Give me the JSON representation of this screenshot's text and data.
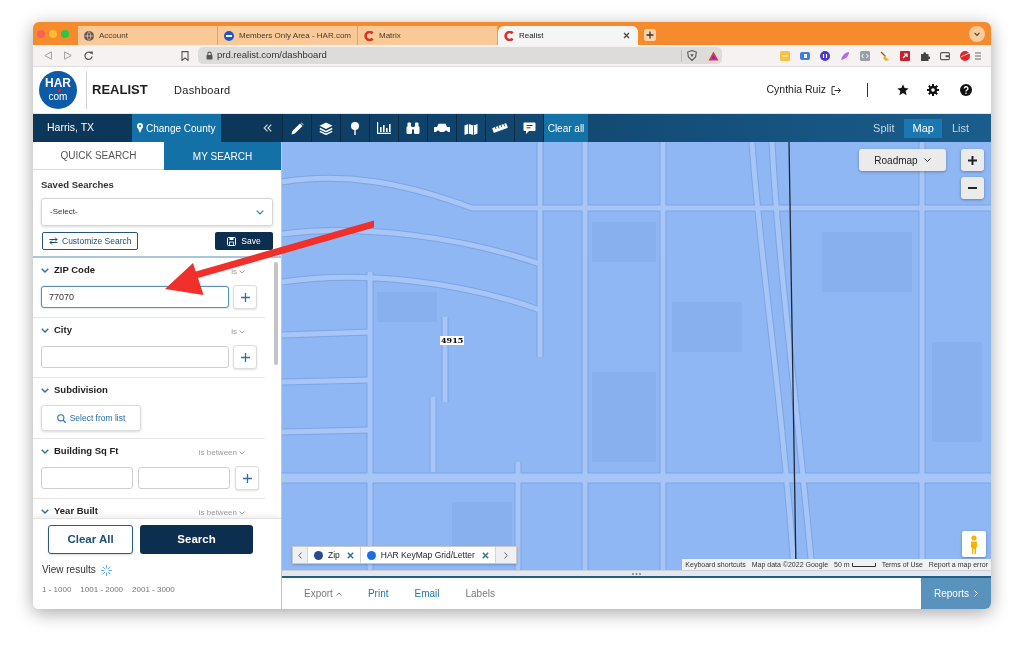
{
  "browser": {
    "tabs": [
      {
        "title": "Account",
        "selected": false
      },
      {
        "title": "Members Only Area - HAR.com",
        "selected": false
      },
      {
        "title": "Matrix",
        "selected": false
      },
      {
        "title": "Realist",
        "selected": true
      }
    ],
    "url": "prd.realist.com/dashboard"
  },
  "header": {
    "logo_top": "HAR",
    "logo_bottom": "com",
    "brand": "REALIST",
    "page_title": "Dashboard",
    "user_name": "Cynthia Ruiz"
  },
  "nav_bar": {
    "county": "Harris, TX",
    "change_county": "Change County",
    "clear_all": "Clear all",
    "views": [
      {
        "label": "Split",
        "selected": false
      },
      {
        "label": "Map",
        "selected": true
      },
      {
        "label": "List",
        "selected": false
      }
    ]
  },
  "sidebar": {
    "tabs": [
      {
        "label": "QUICK SEARCH",
        "selected": false
      },
      {
        "label": "MY SEARCH",
        "selected": true
      }
    ],
    "saved_searches": {
      "label": "Saved Searches",
      "value": "-Select-"
    },
    "customize_button": "Customize Search",
    "save_button": "Save",
    "sections": [
      {
        "kind": "single",
        "title": "ZIP Code",
        "operator": "is",
        "expanded": true,
        "value": "77070",
        "focused": true
      },
      {
        "kind": "single",
        "title": "City",
        "operator": "is",
        "expanded": true,
        "focused": false
      },
      {
        "kind": "list",
        "title": "Subdivision",
        "expanded": true,
        "button": "Select from list"
      },
      {
        "kind": "range",
        "title": "Building Sq Ft",
        "operator": "is between",
        "expanded": true
      },
      {
        "kind": "range",
        "title": "Year Built",
        "operator": "is between",
        "expanded": true
      }
    ],
    "clear_button": "Clear All",
    "search_button": "Search",
    "view_results": "View results",
    "result_ranges": [
      "1 - 1000",
      "1001 - 2000",
      "2001 - 3000"
    ]
  },
  "map": {
    "map_type": "Roadmap",
    "parcel_label": "4915",
    "layers": [
      {
        "name": "Zip",
        "color": "#2a4b8d"
      },
      {
        "name": "HAR KeyMap Grid/Letter",
        "color": "#1b6fe3"
      }
    ],
    "attribution": [
      {
        "text": "Keyboard shortcuts",
        "kind": "link"
      },
      {
        "text": "Map data ©2022 Google",
        "kind": "link"
      },
      {
        "text": "50 m",
        "kind": "scale"
      },
      {
        "text": "Terms of Use",
        "kind": "link"
      },
      {
        "text": "Report a map error",
        "kind": "link"
      }
    ]
  },
  "bottom_bar": {
    "actions": [
      {
        "label": "Export",
        "kind": "menu",
        "disabled": true
      },
      {
        "label": "Print",
        "kind": "link",
        "disabled": false
      },
      {
        "label": "Email",
        "kind": "link",
        "disabled": false
      },
      {
        "label": "Labels",
        "kind": "link",
        "disabled": true
      }
    ],
    "reports_button": "Reports"
  }
}
